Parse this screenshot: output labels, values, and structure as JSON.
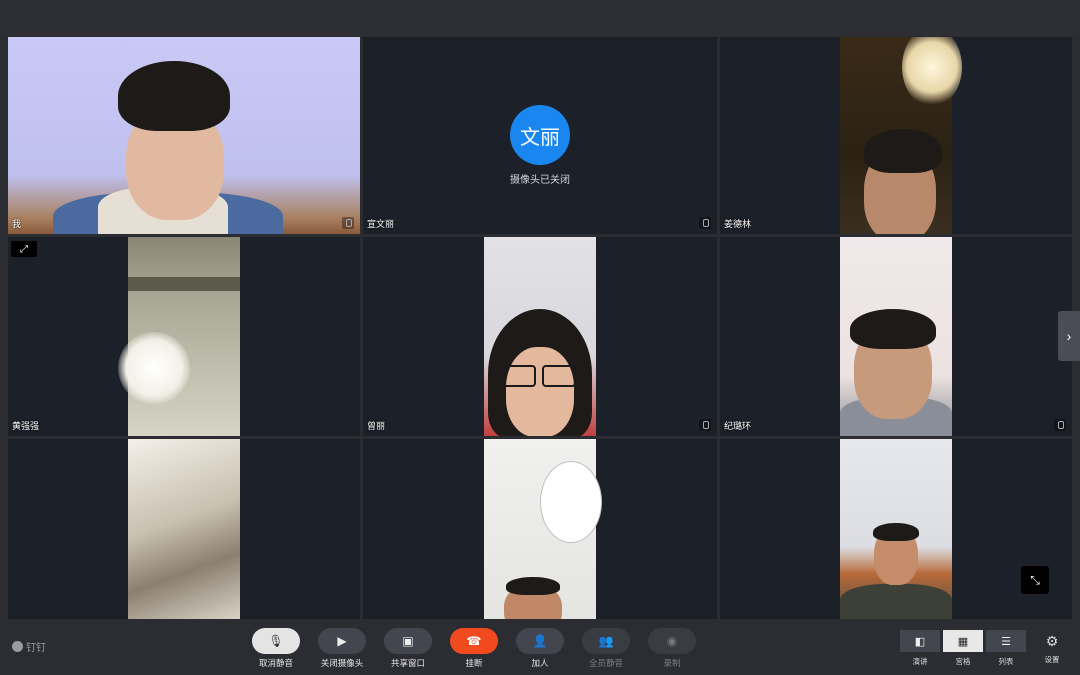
{
  "participants": [
    {
      "name": "我",
      "camera": "on"
    },
    {
      "name": "宣文丽",
      "camera": "off",
      "avatar_text": "文丽",
      "status": "摄像头已关闭"
    },
    {
      "name": "姜德林",
      "camera": "on"
    },
    {
      "name": "黄强强",
      "camera": "on"
    },
    {
      "name": "曾丽",
      "camera": "on"
    },
    {
      "name": "纪璐环",
      "camera": "on"
    },
    {
      "name": "",
      "camera": "on"
    },
    {
      "name": "",
      "camera": "on"
    },
    {
      "name": "",
      "camera": "on"
    }
  ],
  "brand": "钉钉",
  "controls": [
    {
      "label": "取消静音",
      "icon": "mic-icon",
      "style": "light"
    },
    {
      "label": "关闭摄像头",
      "icon": "camera-icon",
      "style": "normal"
    },
    {
      "label": "共享窗口",
      "icon": "screen-share-icon",
      "style": "normal"
    },
    {
      "label": "挂断",
      "icon": "hangup-icon",
      "style": "red"
    },
    {
      "label": "加人",
      "icon": "add-person-icon",
      "style": "normal"
    },
    {
      "label": "全员静音",
      "icon": "mute-all-icon",
      "style": "dim"
    },
    {
      "label": "录制",
      "icon": "record-icon",
      "style": "dim"
    }
  ],
  "views": [
    {
      "label": "演讲",
      "icon": "speaker-view-icon",
      "active": false
    },
    {
      "label": "宫格",
      "icon": "grid-view-icon",
      "active": true
    },
    {
      "label": "列表",
      "icon": "list-view-icon",
      "active": false
    }
  ],
  "settings_label": "设置",
  "colors": {
    "accent_blue": "#1a87f0",
    "hangup_red": "#f04a1e",
    "tile_bg": "#1b2029"
  }
}
